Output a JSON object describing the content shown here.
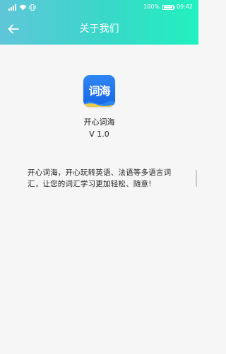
{
  "status_bar": {
    "battery_percent": "100%",
    "time": "09:42"
  },
  "nav": {
    "title": "关于我们",
    "back_icon": "arrow-left-icon"
  },
  "app": {
    "logo_text": "词海",
    "name": "开心词海",
    "version": "V 1.0",
    "description": "开心词海，开心玩转英语、法语等多语言词汇，让您的词汇学习更加轻松、随意!"
  },
  "colors": {
    "header_start": "#5fc6d9",
    "header_end": "#21f1bf",
    "app_icon_blue": "#1f72ec",
    "background": "#f6f6f6"
  }
}
